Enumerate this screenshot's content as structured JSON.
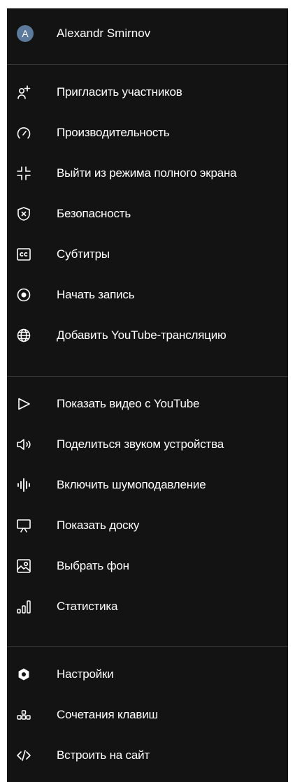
{
  "user": {
    "avatar_letter": "A",
    "name": "Alexandr Smirnov"
  },
  "colors": {
    "menu_background": "#131314",
    "avatar_background": "#5c7a9b",
    "divider": "#3a3a3c",
    "text": "#ffffff"
  },
  "sections": [
    {
      "items": [
        {
          "icon": "add-person-icon",
          "label": "Пригласить участников"
        },
        {
          "icon": "speedometer-icon",
          "label": "Производительность"
        },
        {
          "icon": "exit-fullscreen-icon",
          "label": "Выйти из режима полного экрана"
        },
        {
          "icon": "shield-icon",
          "label": "Безопасность"
        },
        {
          "icon": "closed-captions-icon",
          "label": "Субтитры"
        },
        {
          "icon": "record-icon",
          "label": "Начать запись"
        },
        {
          "icon": "globe-icon",
          "label": "Добавить YouTube-трансляцию"
        }
      ]
    },
    {
      "items": [
        {
          "icon": "play-icon",
          "label": "Показать видео с YouTube"
        },
        {
          "icon": "speaker-icon",
          "label": "Поделиться звуком устройства"
        },
        {
          "icon": "noise-suppression-icon",
          "label": "Включить шумоподавление"
        },
        {
          "icon": "whiteboard-icon",
          "label": "Показать доску"
        },
        {
          "icon": "background-image-icon",
          "label": "Выбрать фон"
        },
        {
          "icon": "statistics-icon",
          "label": "Статистика"
        }
      ]
    },
    {
      "items": [
        {
          "icon": "settings-icon",
          "label": "Настройки"
        },
        {
          "icon": "keyboard-shortcuts-icon",
          "label": "Сочетания клавиш"
        },
        {
          "icon": "code-embed-icon",
          "label": "Встроить на сайт"
        }
      ]
    }
  ]
}
